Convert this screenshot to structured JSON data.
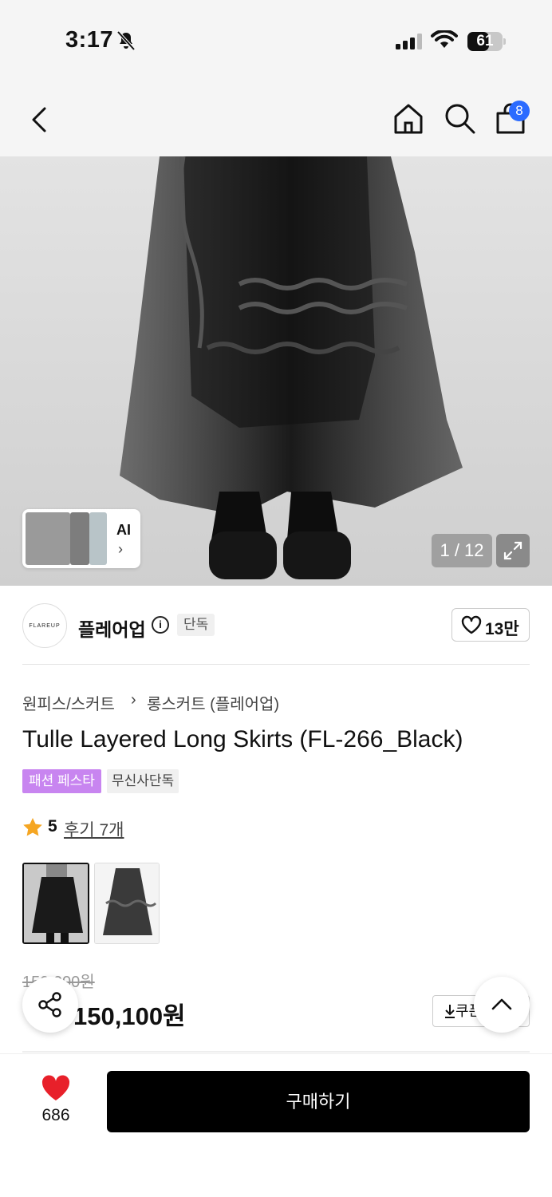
{
  "status_bar": {
    "time": "3:17",
    "battery": "61",
    "battery_level": 0.61
  },
  "nav": {
    "cart_count": "8",
    "icons": [
      "chevron-left-icon",
      "home-icon",
      "search-icon",
      "shopping-bag-icon"
    ]
  },
  "hero": {
    "counter": "1 / 12",
    "ai_label": "AI",
    "ai_chevron": "›"
  },
  "brand": {
    "logo_text": "FLAREUP",
    "name": "플레어업",
    "info": "i",
    "exclusive_tag": "단독",
    "likes": "13만"
  },
  "product": {
    "breadcrumb": [
      "원피스/스커트",
      "롱스커트 (플레어업)"
    ],
    "breadcrumb_sep": "›",
    "title": "Tulle Layered Long Skirts (FL-266_Black)",
    "tags": [
      "패션 페스타",
      "무신사단독"
    ],
    "rating": "5",
    "reviews": "후기 7개",
    "original_price": "150,000원",
    "sale_price": "150,100원",
    "coupon_label": "쿠폰"
  },
  "bottom_bar": {
    "wish_count": "686",
    "buy_label": "구매하기"
  },
  "colors": {
    "accent_blue": "#2b6bff",
    "tag_purple": "#c885f0",
    "heart_red": "#e8202a",
    "star": "#f5a623"
  }
}
